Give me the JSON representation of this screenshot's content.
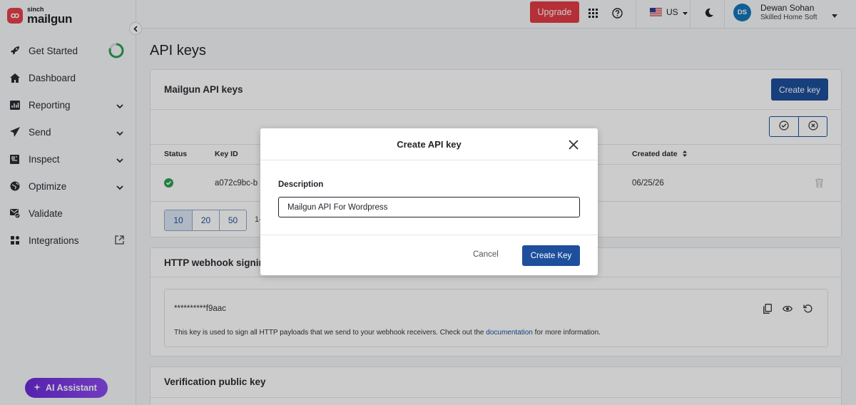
{
  "logo": {
    "top": "sinch",
    "name": "mailgun"
  },
  "nav": [
    {
      "label": "Get Started",
      "name": "get-started",
      "icon": "rocket-icon",
      "chevron": false
    },
    {
      "label": "Dashboard",
      "name": "dashboard",
      "icon": "home-icon",
      "chevron": false
    },
    {
      "label": "Reporting",
      "name": "reporting",
      "icon": "chart-icon",
      "chevron": true
    },
    {
      "label": "Send",
      "name": "send",
      "icon": "paper-plane-icon",
      "chevron": true
    },
    {
      "label": "Inspect",
      "name": "inspect",
      "icon": "inspect-icon",
      "chevron": true
    },
    {
      "label": "Optimize",
      "name": "optimize",
      "icon": "globe-icon",
      "chevron": true
    },
    {
      "label": "Validate",
      "name": "validate",
      "icon": "mail-check-icon",
      "chevron": false
    },
    {
      "label": "Integrations",
      "name": "integrations",
      "icon": "grid-icon",
      "chevron": false
    }
  ],
  "get_started_progress": 0.8,
  "ai_assistant": "AI Assistant",
  "topbar": {
    "upgrade": "Upgrade",
    "region": "US",
    "avatar_initials": "DS",
    "user_name": "Dewan Sohan",
    "user_org": "Skilled Home Soft"
  },
  "page_title": "API keys",
  "api_card": {
    "title": "Mailgun API keys",
    "create_key": "Create key",
    "columns": {
      "status": "Status",
      "key_id": "Key ID",
      "created": "Created date"
    },
    "row": {
      "key_id": "a072c9bc-b",
      "created": "06/25/26"
    },
    "page_sizes": [
      "10",
      "20",
      "50"
    ],
    "pager_info": "1-"
  },
  "webhook_card": {
    "title": "HTTP webhook signing",
    "secret": "**********f9aac",
    "note_before": "This key is used to sign all HTTP payloads that we send to your webhook receivers. Check out the ",
    "note_link": "documentation",
    "note_after": " for more information."
  },
  "verification_card": {
    "title": "Verification public key"
  },
  "modal": {
    "title": "Create API key",
    "field_label": "Description",
    "field_value": "Mailgun API For Wordpress",
    "cancel": "Cancel",
    "submit": "Create Key"
  },
  "colors": {
    "brand_red": "#e5424d",
    "primary_blue": "#1d4f9c",
    "success_green": "#2e9e55"
  }
}
